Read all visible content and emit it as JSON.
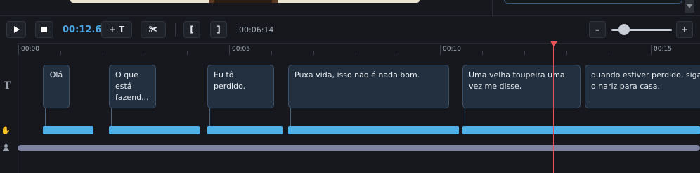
{
  "player": {
    "current_time": "00:12.6",
    "total_time": "00:06:14"
  },
  "toolbar": {
    "play_icon": "play-icon",
    "stop_icon": "stop-icon",
    "add_text_label": "+ T",
    "split_glyph": "✀",
    "mark_in_label": "[",
    "mark_out_label": "]",
    "zoom_out_label": "–",
    "zoom_in_label": "+"
  },
  "ruler": {
    "labels": [
      "00:00",
      "00:05",
      "00:10",
      "00:15"
    ]
  },
  "lanes": {
    "text_icon": "T",
    "hand_icon": "✋"
  },
  "subtitles": [
    {
      "text": "Olá"
    },
    {
      "text": "O que está fazend..."
    },
    {
      "text": "Eu tô perdido."
    },
    {
      "text": "Puxa vida, isso não é nada bom."
    },
    {
      "text": "Uma velha toupeira uma vez me disse,"
    },
    {
      "text": "quando estiver perdido, siga o nariz para casa."
    }
  ],
  "colors": {
    "accent": "#4aa8e8",
    "clip_bar": "#4eb1ea",
    "playhead": "#e8525a",
    "audio_track": "#7d83a0"
  }
}
